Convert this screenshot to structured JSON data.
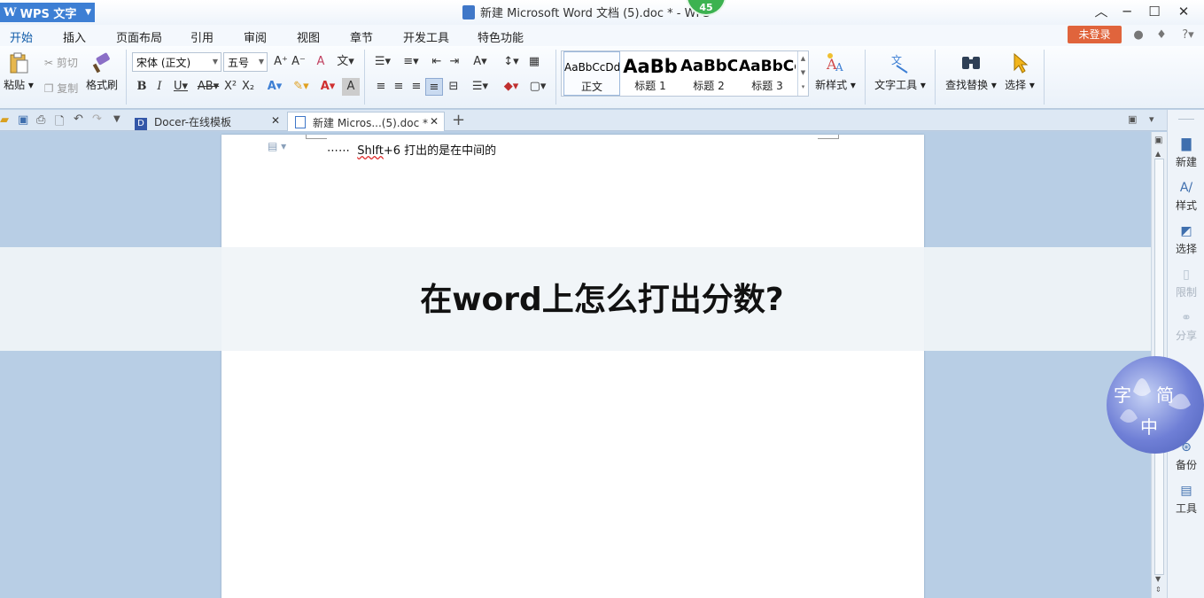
{
  "app": {
    "name": "WPS 文字",
    "logo": "W"
  },
  "window": {
    "title": "新建 Microsoft Word 文档 (5).doc * - WPS",
    "badge": "45"
  },
  "menu": {
    "tabs": [
      "开始",
      "插入",
      "页面布局",
      "引用",
      "审阅",
      "视图",
      "章节",
      "开发工具",
      "特色功能"
    ],
    "active": "开始",
    "login": "未登录"
  },
  "ribbon": {
    "paste": "粘贴",
    "cut": "剪切",
    "copy": "复制",
    "format_painter": "格式刷",
    "font_name": "宋体 (正文)",
    "font_size": "五号",
    "styles": [
      {
        "preview": "AaBbCcDd",
        "label": "正文"
      },
      {
        "preview": "AaBb",
        "label": "标题 1"
      },
      {
        "preview": "AaBbC",
        "label": "标题 2"
      },
      {
        "preview": "AaBbCc",
        "label": "标题 3"
      }
    ],
    "new_style": "新样式",
    "text_tools": "文字工具",
    "find_replace": "查找替换",
    "select": "选择"
  },
  "doc_tabs": [
    {
      "label": "Docer-在线模板"
    },
    {
      "label": "新建 Micros...(5).doc *"
    }
  ],
  "document": {
    "line1_prefix": "⋯⋯",
    "line1_err": "Shlft",
    "line1_rest": "+6 打出的是在中间的",
    "banner_title": "在word上怎么打出分数?"
  },
  "right_pane": [
    {
      "label": "新建",
      "icon": "new-doc-icon",
      "dim": false
    },
    {
      "label": "样式",
      "icon": "style-icon",
      "dim": false
    },
    {
      "label": "选择",
      "icon": "select-icon",
      "dim": false
    },
    {
      "label": "限制",
      "icon": "restrict-icon",
      "dim": true
    },
    {
      "label": "分享",
      "icon": "share-icon",
      "dim": true
    },
    {
      "label": "备份",
      "icon": "backup-icon",
      "dim": false
    },
    {
      "label": "工具",
      "icon": "toolbox-icon",
      "dim": false
    }
  ],
  "watermark": [
    "字",
    "简",
    "中"
  ],
  "colors": {
    "accent": "#3d7fd4",
    "login": "#e0643c",
    "badge": "#3cb250",
    "workspace": "#b8cee5"
  }
}
